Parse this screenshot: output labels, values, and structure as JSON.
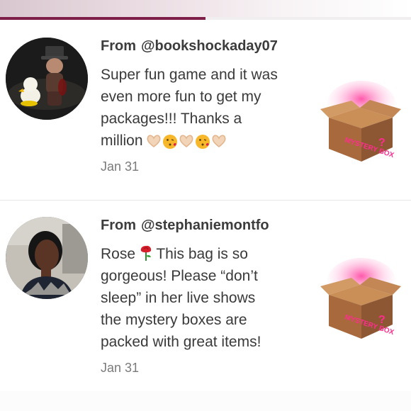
{
  "header": {
    "progress_percent": 50,
    "colors": {
      "progress": "#7d1f49",
      "accent": "#e11d74"
    }
  },
  "reviews": [
    {
      "from_label": "From",
      "handle": "@bookshockaday07",
      "body": "Super fun game and it was\neven more fun to get my\npackages!!! Thanks a\nmillion",
      "emojis": [
        "heart-hands",
        "kiss-face",
        "heart-hands",
        "kiss-face",
        "heart-hands"
      ],
      "date": "Jan 31",
      "box_label": "MYSTERY BOX"
    },
    {
      "from_label": "From",
      "handle": "@stephaniemontfo",
      "body_prefix": "Rose",
      "body_emoji": "rose",
      "body_rest": "This bag is so\ngorgeous! Please “don’t\nsleep” in her live shows\nthe mystery boxes are\npacked with great items!",
      "date": "Jan 31",
      "box_label": "MYSTERY BOX"
    }
  ]
}
